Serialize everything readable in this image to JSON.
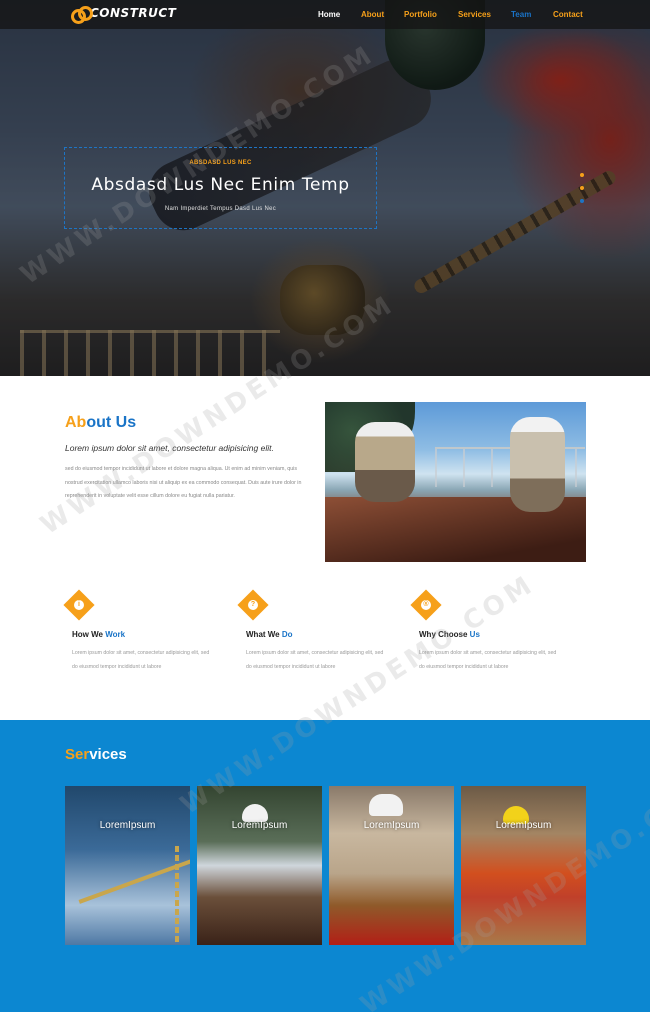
{
  "brand": {
    "name": "CONSTRUCT"
  },
  "nav": {
    "items": [
      "Home",
      "About",
      "Portfolio",
      "Services",
      "Team",
      "Contact"
    ]
  },
  "hero": {
    "eyebrow": "ABSDASD LUS NEC",
    "title": "Absdasd Lus Nec Enim Temp",
    "subtitle": "Nam Imperdiet Tempus Dasd Lus Nec"
  },
  "about": {
    "title_highlight": "Ab",
    "title_rest": "out Us",
    "lead": "Lorem ipsum dolor sit amet, consectetur adipisicing elit.",
    "body": "sed do eiusmod tempor incididunt ut labore et dolore magna aliqua. Ut enim ad minim veniam, quis nostrud exercitation ullamco laboris nisi ut aliquip ex ea commodo consequat. Duis aute irure dolor in reprehenderit in voluptate velit esse cillum dolore eu fugiat nulla pariatur."
  },
  "features": [
    {
      "title_a": "How We ",
      "title_b": "Work",
      "icon": "i",
      "text": "Lorem ipsum dolor sit amet, consectetur adipisicing elit, sed do eiusmod tempor incididunt ut labore"
    },
    {
      "title_a": "What We ",
      "title_b": "Do",
      "icon": "?",
      "text": "Lorem ipsum dolor sit amet, consectetur adipisicing elit, sed do eiusmod tempor incididunt ut labore"
    },
    {
      "title_a": "Why Choose ",
      "title_b": "Us",
      "icon": "®",
      "text": "Lorem ipsum dolor sit amet, consectetur adipisicing elit, sed do eiusmod tempor incididunt ut labore"
    }
  ],
  "services": {
    "title_highlight": "Ser",
    "title_rest": "vices",
    "cards": [
      "LoremIpsum",
      "LoremIpsum",
      "LoremIpsum",
      "LoremIpsum"
    ]
  },
  "watermark": "WWW.DOWNDEMO.COM",
  "colors": {
    "accent": "#f6a01a",
    "primary": "#0c87d1",
    "link_blue": "#1a74c7"
  }
}
